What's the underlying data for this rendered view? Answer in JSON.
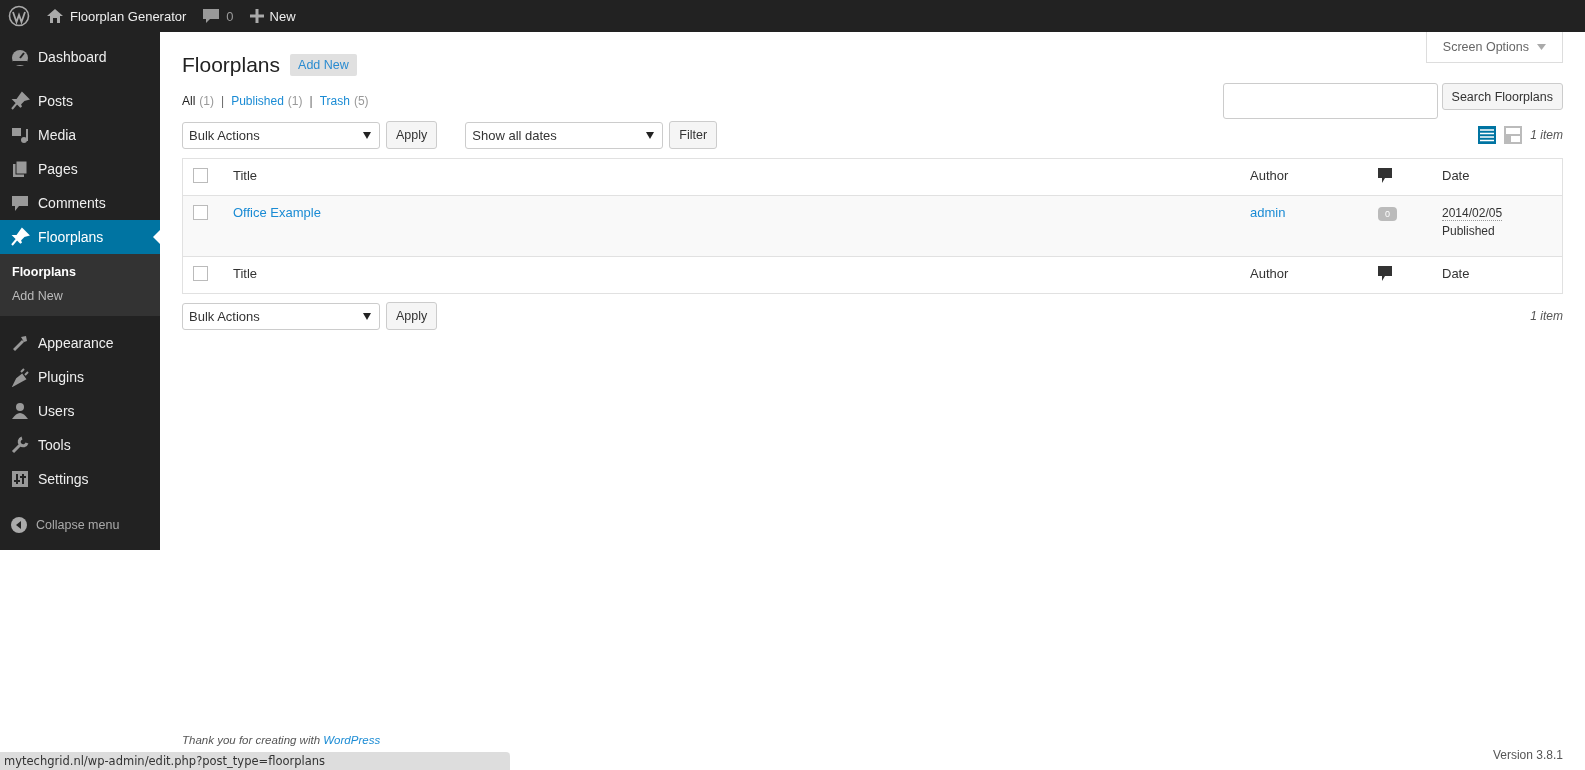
{
  "admin_bar": {
    "site_name": "Floorplan Generator",
    "comments_count": "0",
    "new_label": "New"
  },
  "sidebar": {
    "groups": [
      [
        {
          "label": "Dashboard",
          "selected": false
        }
      ],
      [
        {
          "label": "Posts",
          "selected": false
        },
        {
          "label": "Media",
          "selected": false
        },
        {
          "label": "Pages",
          "selected": false
        },
        {
          "label": "Comments",
          "selected": false
        },
        {
          "label": "Floorplans",
          "selected": true,
          "children": [
            {
              "label": "Floorplans",
              "selected": true
            },
            {
              "label": "Add New",
              "selected": false
            }
          ]
        }
      ],
      [
        {
          "label": "Appearance",
          "selected": false
        },
        {
          "label": "Plugins",
          "selected": false
        },
        {
          "label": "Users",
          "selected": false
        },
        {
          "label": "Tools",
          "selected": false
        },
        {
          "label": "Settings",
          "selected": false
        }
      ]
    ],
    "collapse_label": "Collapse menu"
  },
  "screen_options": "Screen Options",
  "heading": "Floorplans",
  "add_new": "Add New",
  "views": [
    {
      "label": "All",
      "count": "(1)",
      "selected": true
    },
    {
      "separator": "|",
      "label": "Published",
      "count": "(1)",
      "selected": false
    },
    {
      "separator": "|",
      "label": "Trash",
      "count": "(5)",
      "selected": false
    }
  ],
  "search_button": "Search Floorplans",
  "bulk_actions": "Bulk Actions",
  "apply": "Apply",
  "date_filter": "Show all dates",
  "filter": "Filter",
  "view_modes": [
    {
      "kind": "list",
      "selected": true
    },
    {
      "kind": "excerpt",
      "selected": false
    }
  ],
  "item_count": "1 item",
  "table": {
    "header": {
      "checked": false,
      "columns": [
        "Title",
        "Author",
        "Date"
      ]
    },
    "rows": [
      {
        "checked": false,
        "title": "Office Example",
        "author": "admin",
        "comments": "0",
        "date": "2014/02/05",
        "status": "Published"
      }
    ],
    "footer": {
      "checked": false,
      "columns": [
        "Title",
        "Author",
        "Date"
      ]
    }
  },
  "bottom": {
    "bulk_actions": "Bulk Actions",
    "apply": "Apply",
    "item_count": "1 item"
  },
  "footer": {
    "thanks": "Thank you for creating with ",
    "link": "WordPress",
    "version": "Version 3.8.1"
  },
  "status_url": "mytechgrid.nl/wp-admin/edit.php?post_type=floorplans"
}
